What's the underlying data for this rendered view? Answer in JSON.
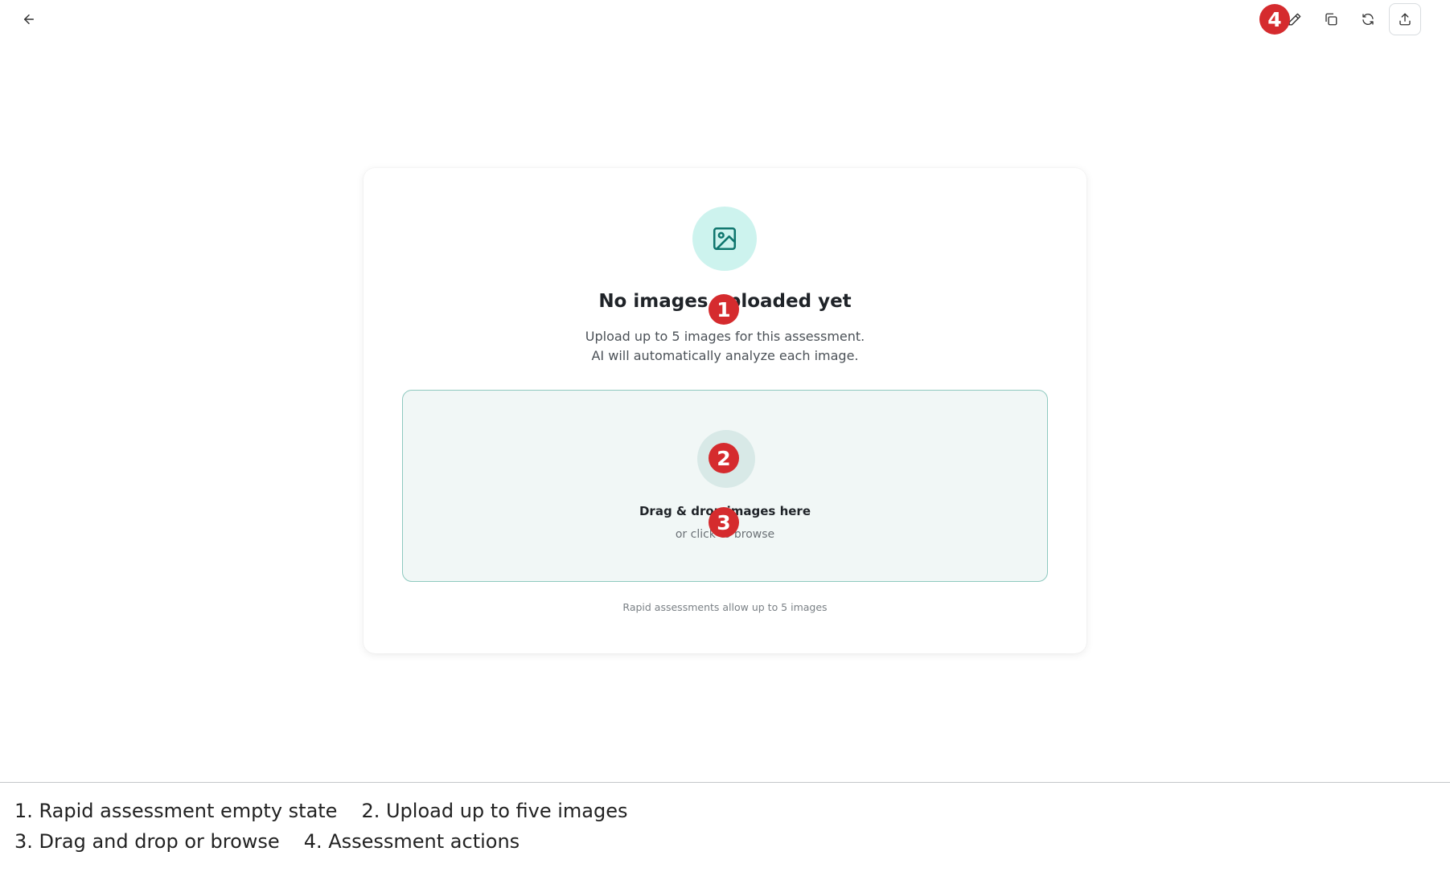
{
  "toolbar": {
    "back_icon": "arrow-left-icon",
    "actions": [
      {
        "icon": "pencil-icon",
        "label": "Edit"
      },
      {
        "icon": "copy-icon",
        "label": "Duplicate"
      },
      {
        "icon": "refresh-icon",
        "label": "Refresh"
      },
      {
        "icon": "share-upload-icon",
        "label": "Export"
      }
    ]
  },
  "empty_state": {
    "icon": "image-icon",
    "title": "No images uploaded yet",
    "subtitle_line1": "Upload up to 5 images for this assessment.",
    "subtitle_line2": "AI will automatically analyze each image."
  },
  "dropzone": {
    "icon": "upload-icon",
    "title": "Drag & drop images here",
    "subtitle": "or click to browse"
  },
  "note": "Rapid assessments allow up to 5 images",
  "markers": [
    "1",
    "2",
    "3",
    "4"
  ],
  "legend": {
    "item1": "1. Rapid assessment empty state",
    "item2": "2. Upload up to five images",
    "item3": "3. Drag and drop or browse",
    "item4": "4. Assessment actions"
  },
  "colors": {
    "accent": "#0f766e",
    "marker": "#d52b2e",
    "hero_bg": "#cdf3ee",
    "dropzone_bg": "#f1f7f6",
    "dropzone_border": "#8ec9bf"
  }
}
